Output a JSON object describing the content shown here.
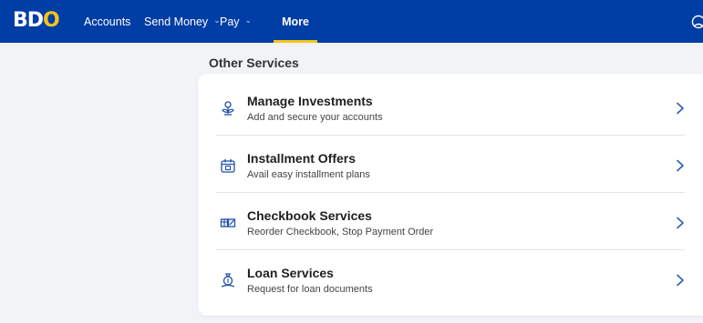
{
  "brand": {
    "logo_b": "B",
    "logo_d": "D",
    "logo_o": "O"
  },
  "nav": {
    "accounts": "Accounts",
    "send_money": "Send Money",
    "pay": "Pay",
    "more": "More"
  },
  "colors": {
    "header_bg": "#003da5",
    "accent": "#f5c41b",
    "icon": "#1d4ea8",
    "chevron": "#2a5bb8"
  },
  "section_title": "Other Services",
  "services": [
    {
      "title": "Manage Investments",
      "subtitle": "Add and secure your accounts",
      "icon": "plant-coin-icon"
    },
    {
      "title": "Installment Offers",
      "subtitle": "Avail easy installment plans",
      "icon": "calendar-icon"
    },
    {
      "title": "Checkbook Services",
      "subtitle": "Reorder Checkbook, Stop Payment Order",
      "icon": "checkbook-icon"
    },
    {
      "title": "Loan Services",
      "subtitle": "Request for loan documents",
      "icon": "money-bag-icon"
    }
  ]
}
